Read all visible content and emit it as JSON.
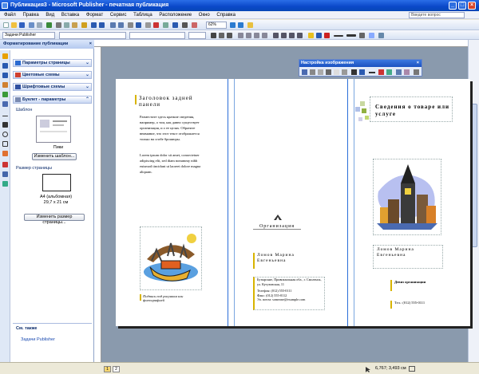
{
  "window": {
    "title": "Публикация3 - Microsoft Publisher - печатная публикация"
  },
  "menu": {
    "items": [
      "Файл",
      "Правка",
      "Вид",
      "Вставка",
      "Формат",
      "Сервис",
      "Таблица",
      "Расположение",
      "Окно",
      "Справка"
    ],
    "help_placeholder": "Введите вопрос"
  },
  "toolbar": {
    "zoom": "62%",
    "tasks_label": "Задачи Publisher"
  },
  "taskpane": {
    "title": "Форматирование публикации",
    "sections": [
      "Параметры страницы",
      "Цветовые схемы",
      "Шрифтовые схемы",
      "Буклет - параметры"
    ],
    "template_label": "Шаблон",
    "template_name": "Пики",
    "change_template_button": "Изменить шаблон...",
    "page_size_label": "Размер страницы",
    "page_size_name": "A4 (альбомная)",
    "page_size_dims": "29,7 x 21 см",
    "change_size_button": "Изменить размер страницы...",
    "see_also": "См. также",
    "tasks_link": "Задачи Publisher"
  },
  "picture_toolbar": {
    "title": "Настройка изображения"
  },
  "brochure": {
    "panel1": {
      "heading": "Заголовок задней панели",
      "body1": "Разместите здесь краткие сведения, например, о том, как давно существует организация, и о ее целях. Обратите внимание, что этот текст отображается только на сгибе брошюры.",
      "body2": "Lorem ipsum dolor sit amet, consectetuer adipiscing elit, sed diam nonummy nibh euismod tincidunt ut laoreet dolore magna aliquam.",
      "caption": "Подпись под рисунком или фотографией"
    },
    "panel2": {
      "org_name": "Организация",
      "contact_name": "Ломов Марина Евгеньевна",
      "address": "Бутырские, Привокзальная обл., г. Смоленск, ул. Кутузовская, 11",
      "phone": "Телефон: (012) 555-0111",
      "fax": "Факс: (012) 555-0112",
      "email": "Эл. почта: someone@example.com"
    },
    "panel3": {
      "title": "Сведения о товаре или услуге",
      "name": "Ломов Марина Евгеньевна",
      "tagline": "Девиз организации",
      "phone": "Тел.: (012) 555-0111"
    }
  },
  "status": {
    "pages": [
      "1",
      "2"
    ],
    "coords": "6,767; 3,493 см"
  }
}
